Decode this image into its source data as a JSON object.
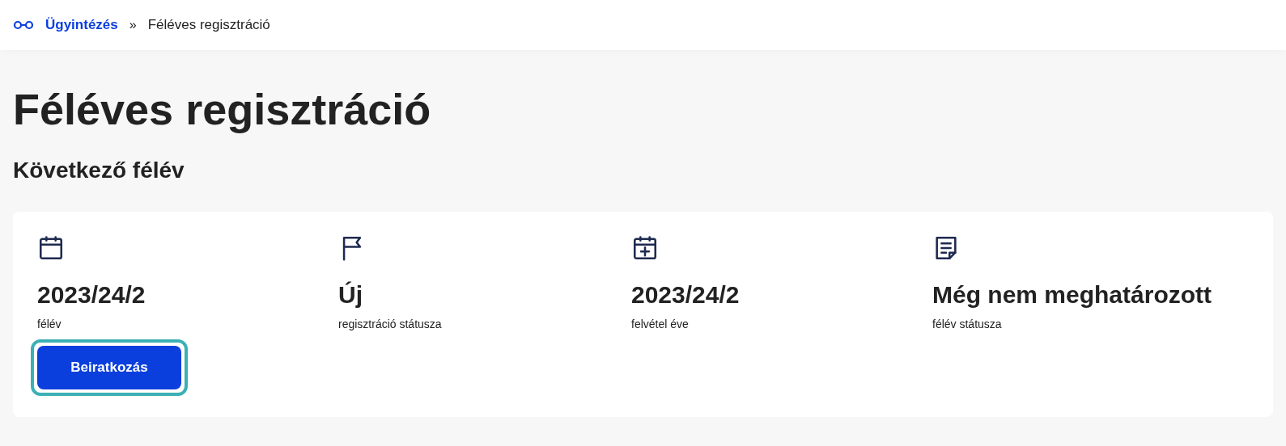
{
  "breadcrumb": [
    {
      "label": "Ügyintézés",
      "kind": "link"
    },
    {
      "label": "Féléves regisztráció",
      "kind": "current"
    }
  ],
  "breadcrumb_separator": "»",
  "title": "Féléves regisztráció",
  "section_title": "Következő félév",
  "stats": [
    {
      "kind": "calendar",
      "value": "2023/24/2",
      "label": "félév"
    },
    {
      "kind": "flag",
      "value": "Új",
      "label": "regisztráció státusza"
    },
    {
      "kind": "calendar-plus",
      "value": "2023/24/2",
      "label": "felvétel éve"
    },
    {
      "kind": "note",
      "value": "Még nem meghatározott",
      "label": "félév státusza"
    }
  ],
  "button": {
    "label": "Beiratkozás",
    "focused": true
  }
}
